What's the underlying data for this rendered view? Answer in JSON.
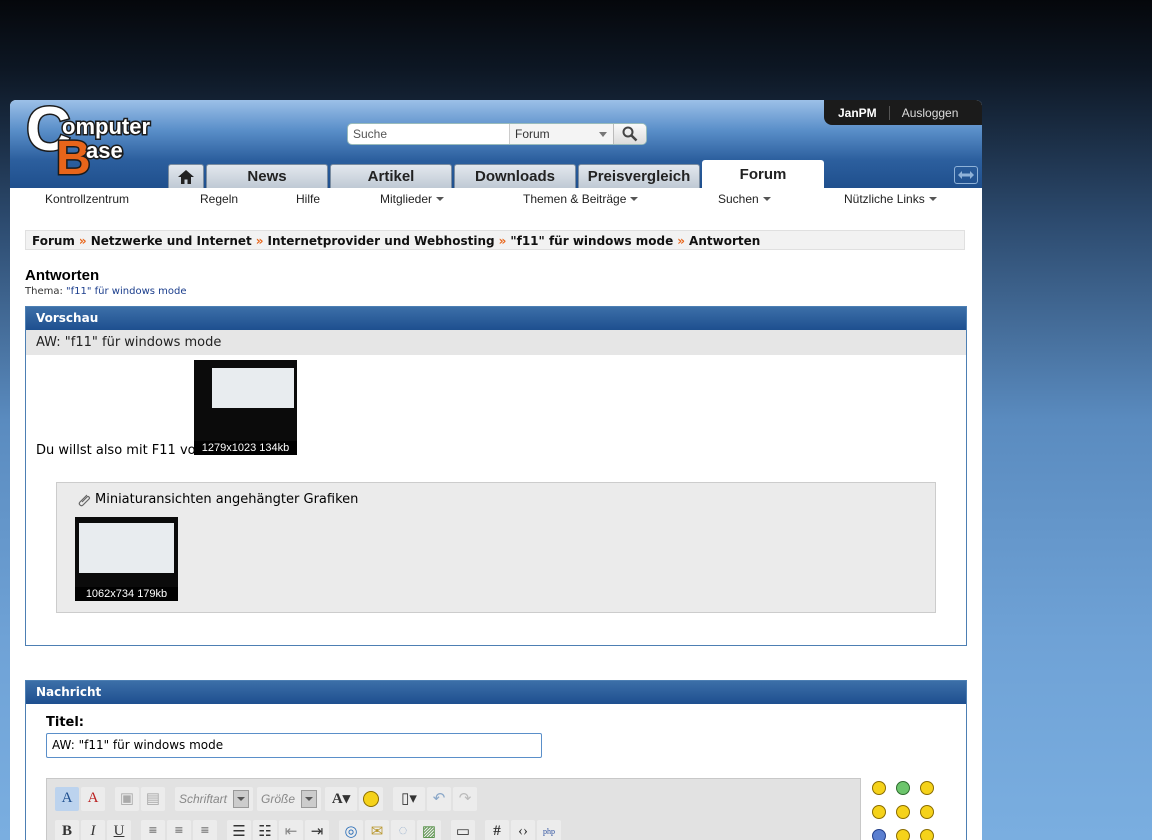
{
  "brand": {
    "logo_line1": "omputer",
    "logo_line2": "ase",
    "logo_c": "C",
    "logo_b": "B"
  },
  "user": {
    "name": "JanPM",
    "logout": "Ausloggen"
  },
  "search": {
    "placeholder": "Suche",
    "scope": "Forum"
  },
  "tabs": [
    "News",
    "Artikel",
    "Downloads",
    "Preisvergleich",
    "Forum"
  ],
  "subnav": [
    "Kontrollzentrum",
    "Regeln",
    "Hilfe",
    "Mitglieder",
    "Themen & Beiträge",
    "Suchen",
    "Nützliche Links"
  ],
  "breadcrumb": [
    "Forum",
    "Netzwerke und Internet",
    "Internetprovider und Webhosting",
    "\"f11\" für windows mode",
    "Antworten"
  ],
  "breadcrumb_sep": "»",
  "page": {
    "title": "Antworten",
    "thema_label": "Thema:",
    "thema_link": "\"f11\" für windows mode"
  },
  "preview": {
    "header": "Vorschau",
    "post_title": "AW: \"f11\" für windows mode",
    "text": "Du willst also mit F11 von",
    "image_caption": "1279x1023 134kb",
    "attachments_label": "Miniaturansichten angehängter Grafiken",
    "attachment_caption": "1062x734 179kb"
  },
  "message": {
    "header": "Nachricht",
    "title_label": "Titel:",
    "title_value": "AW: \"f11\" für windows mode"
  },
  "editor": {
    "font_label": "Schriftart",
    "size_label": "Größe"
  },
  "colors": {
    "accent": "#1e4f8f",
    "crumb_sep": "#e8651a"
  }
}
